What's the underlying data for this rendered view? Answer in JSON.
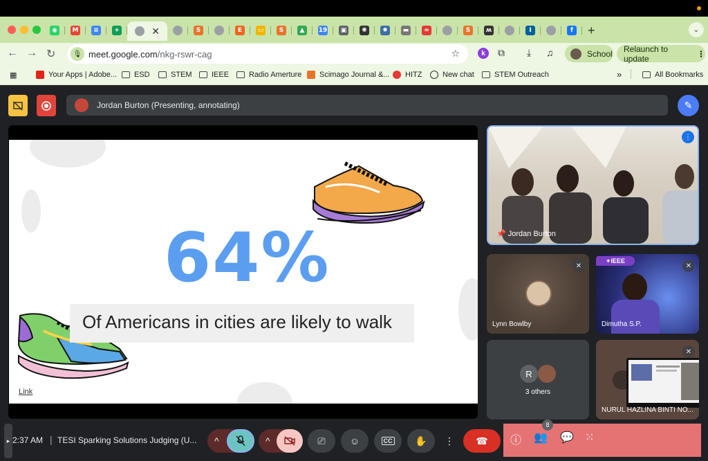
{
  "browser": {
    "tabs": [
      {
        "icon": "whatsapp-icon",
        "color": "#25d366",
        "glyph": "◉"
      },
      {
        "icon": "gmail-icon",
        "color": "#ea4335",
        "glyph": "M"
      },
      {
        "icon": "docs-icon",
        "color": "#4285f4",
        "glyph": "≡"
      },
      {
        "icon": "sheets-icon",
        "color": "#0f9d58",
        "glyph": "+"
      },
      {
        "icon": "meet-icon",
        "color": "#9aa0a6",
        "glyph": "",
        "active": true
      },
      {
        "icon": "generic-icon",
        "color": "#9aa0a6",
        "glyph": ""
      },
      {
        "icon": "sjr-icon",
        "color": "#e8742b",
        "glyph": "S"
      },
      {
        "icon": "generic-icon",
        "color": "#9aa0a6",
        "glyph": ""
      },
      {
        "icon": "etsy-icon",
        "color": "#f1641e",
        "glyph": "E"
      },
      {
        "icon": "slides-icon",
        "color": "#f4b400",
        "glyph": "▭"
      },
      {
        "icon": "sc-icon",
        "color": "#e8742b",
        "glyph": "S"
      },
      {
        "icon": "drive-icon",
        "color": "#34a853",
        "glyph": "▲"
      },
      {
        "icon": "calendar-icon",
        "color": "#4285f4",
        "glyph": "19"
      },
      {
        "icon": "reader-icon",
        "color": "#5f6368",
        "glyph": "▣"
      },
      {
        "icon": "chatgpt-icon",
        "color": "#333333",
        "glyph": "✺"
      },
      {
        "icon": "gear-icon",
        "color": "#3b6ea5",
        "glyph": "✹"
      },
      {
        "icon": "image-icon",
        "color": "#777777",
        "glyph": "▬"
      },
      {
        "icon": "hitz-icon",
        "color": "#e53935",
        "glyph": "≈"
      },
      {
        "icon": "generic-icon",
        "color": "#9aa0a6",
        "glyph": ""
      },
      {
        "icon": "sc-icon",
        "color": "#e8742b",
        "glyph": "S"
      },
      {
        "icon": "miro-icon",
        "color": "#333333",
        "glyph": "ʍ"
      },
      {
        "icon": "generic-icon",
        "color": "#9aa0a6",
        "glyph": ""
      },
      {
        "icon": "ieee-icon",
        "color": "#00629b",
        "glyph": "I"
      },
      {
        "icon": "generic-icon",
        "color": "#9aa0a6",
        "glyph": ""
      },
      {
        "icon": "facebook-icon",
        "color": "#1877f2",
        "glyph": "f"
      }
    ],
    "new_tab": "+",
    "url_host": "meet.google.com",
    "url_path": "/nkg-rswr-cag",
    "profile": "School",
    "relaunch": "Relaunch to update",
    "k_badge": "k"
  },
  "bookmarks": [
    {
      "label": "",
      "kind": "apps"
    },
    {
      "label": "Your Apps | Adobe...",
      "kind": "adobe"
    },
    {
      "label": "ESD",
      "kind": "folder"
    },
    {
      "label": "STEM",
      "kind": "folder"
    },
    {
      "label": "IEEE",
      "kind": "folder"
    },
    {
      "label": "Radio Amerture",
      "kind": "folder"
    },
    {
      "label": "Scimago Journal &...",
      "kind": "sjr"
    },
    {
      "label": "HITZ",
      "kind": "hitz"
    },
    {
      "label": "New chat",
      "kind": "chat"
    },
    {
      "label": "STEM Outreach",
      "kind": "folder"
    }
  ],
  "bookmarks_more": "»",
  "all_bookmarks": "All Bookmarks",
  "meet": {
    "presenter": "Jordan Burton (Presenting, annotating)",
    "slide": {
      "stat": "64%",
      "caption": "Of Americans in cities are likely to walk",
      "link": "Link"
    },
    "participants": {
      "main": "Jordan Burton",
      "p1": "Lynn Bowlby",
      "p2": "Dimutha S.P.",
      "p2_badge": "IEEE",
      "p3_initial": "R",
      "p3": "3 others",
      "p4": "NURUL HAZLINA BINTI NO..."
    },
    "time": "2:37 AM",
    "meeting_title": "TESI Sparking Solutions Judging (U...",
    "people_count": "8"
  }
}
